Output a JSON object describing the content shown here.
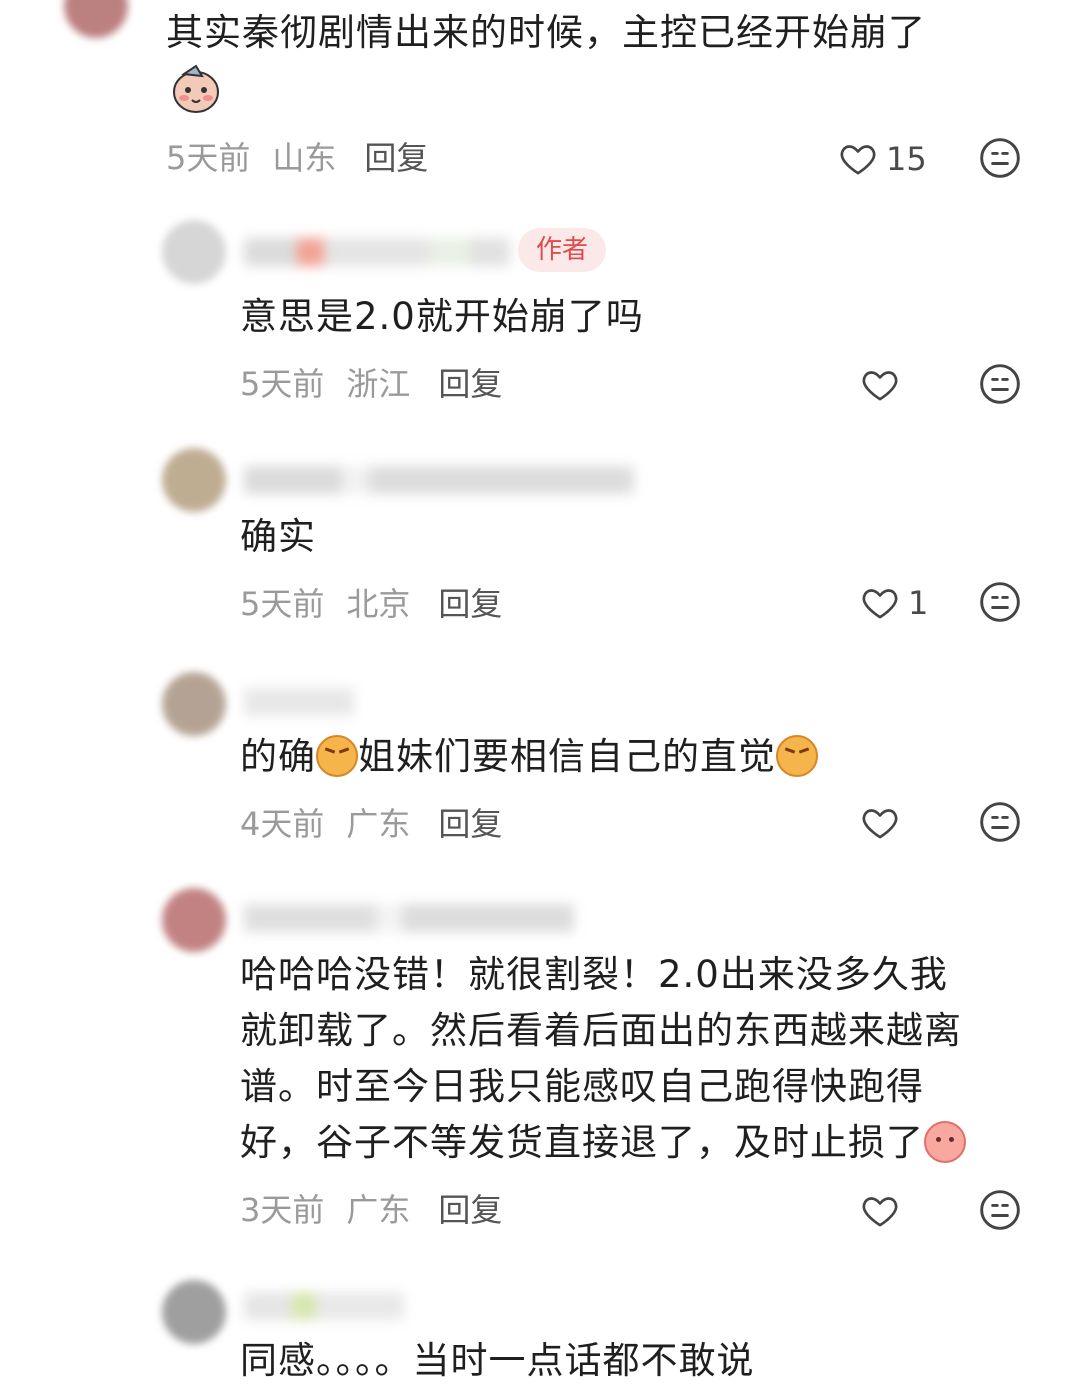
{
  "comments": [
    {
      "text_lines": [
        "其实秦彻剧情出来的时候，主控已经开始崩了"
      ],
      "time": "5天前",
      "region": "山东",
      "reply": "回复",
      "likes": "15"
    },
    {
      "author_tag": "作者",
      "text_lines": [
        "意思是2.0就开始崩了吗"
      ],
      "time": "5天前",
      "region": "浙江",
      "reply": "回复",
      "likes": ""
    },
    {
      "text_lines": [
        "确实"
      ],
      "time": "5天前",
      "region": "北京",
      "reply": "回复",
      "likes": "1"
    },
    {
      "text_a": "的确",
      "text_b": "姐妹们要相信自己的直觉",
      "time": "4天前",
      "region": "广东",
      "reply": "回复",
      "likes": ""
    },
    {
      "text_lines": [
        "哈哈哈没错！就很割裂！2.0出来没多久我",
        "就卸载了。然后看着后面出的东西越来越离",
        "谱。时至今日我只能感叹自己跑得快跑得",
        "好，谷子不等发货直接退了，及时止损了"
      ],
      "time": "3天前",
      "region": "广东",
      "reply": "回复",
      "likes": ""
    },
    {
      "text_lines": [
        "同感。。。。当时一点话都不敢说"
      ]
    }
  ],
  "icons": {
    "like": "heart-outline-icon",
    "dislike": "meh-face-icon",
    "emoji_cat": "angry-cat-emoji-icon",
    "emoji_peach": "peach-face-emoji-icon",
    "emoji_bird": "bird-face-emoji-icon"
  },
  "colors": {
    "author_tag_bg": "#fbe9e9",
    "author_tag_text": "#e14b4b",
    "meta": "#9a9a9a"
  }
}
